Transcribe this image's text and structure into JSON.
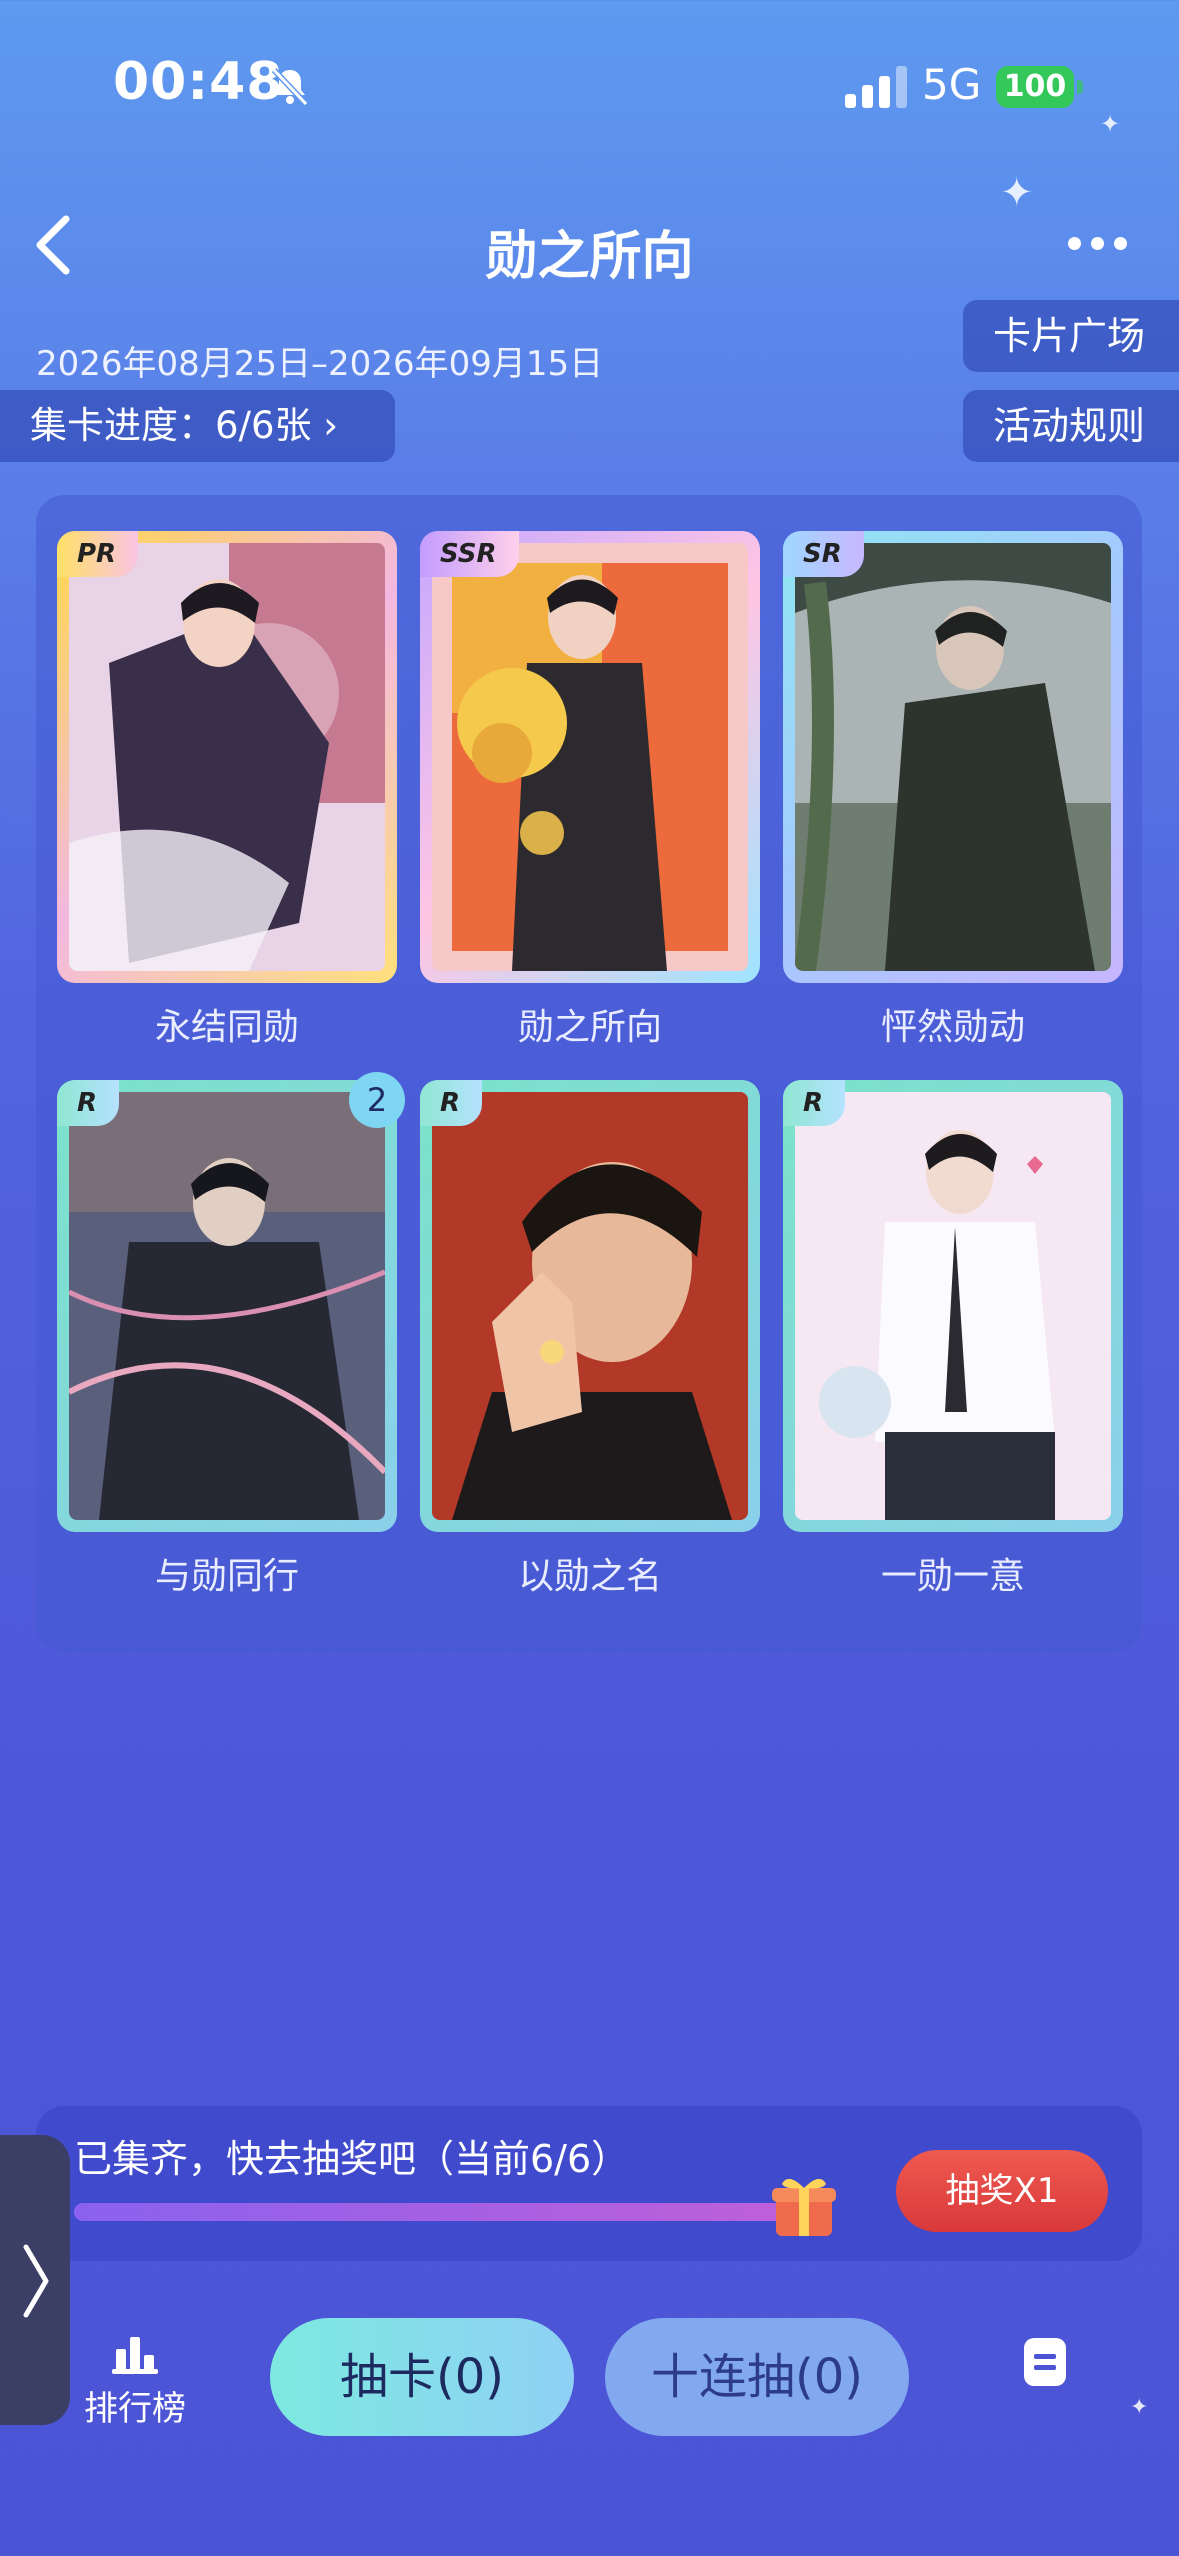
{
  "status_bar": {
    "time": "00:48",
    "network": "5G",
    "battery": "100"
  },
  "header": {
    "title": "勋之所向",
    "date_range": "2026年08月25日–2026年09月15日"
  },
  "side_buttons": {
    "plaza": "卡片广场",
    "rules": "活动规则"
  },
  "progress": {
    "label": "集卡进度：6/6张 ›"
  },
  "cards": [
    {
      "name": "永结同勋",
      "rarity": "PR"
    },
    {
      "name": "勋之所向",
      "rarity": "SSR"
    },
    {
      "name": "怦然勋动",
      "rarity": "SR"
    },
    {
      "name": "与勋同行",
      "rarity": "R",
      "count": "2"
    },
    {
      "name": "以勋之名",
      "rarity": "R"
    },
    {
      "name": "一勋一意",
      "rarity": "R"
    }
  ],
  "lottery": {
    "text": "已集齐，快去抽奖吧（当前6/6）",
    "progress_fraction": 1.0,
    "button": "抽奖X1"
  },
  "bottom": {
    "rank_label": "排行榜",
    "draw_label": "抽卡(0)",
    "ten_draw_label": "十连抽(0)"
  },
  "icons": [
    "bell-muted-icon",
    "signal-icon",
    "back-icon",
    "more-icon",
    "gift-icon",
    "chevron-right-icon",
    "rank-icon",
    "document-icon"
  ]
}
